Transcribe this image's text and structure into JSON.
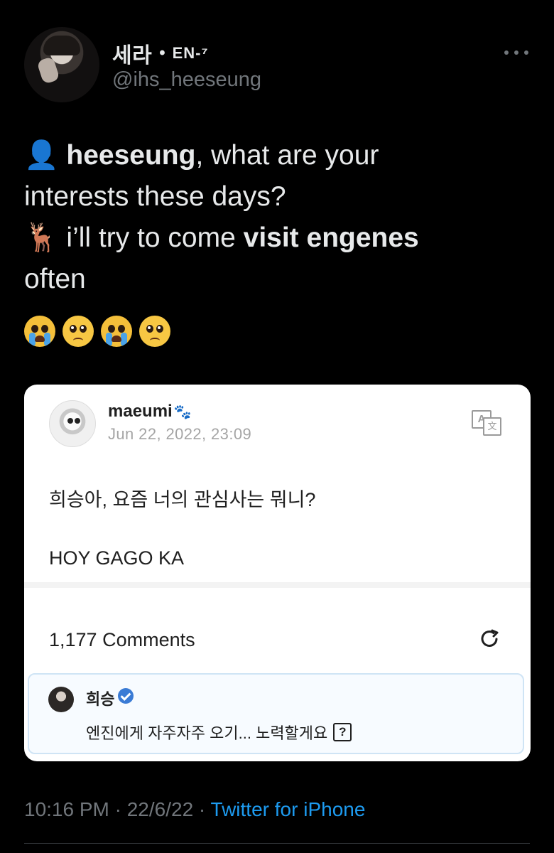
{
  "author": {
    "display_name": "세라",
    "separator": "•",
    "tag": "EN-⁷",
    "handle": "@ihs_heeseung"
  },
  "tweet": {
    "line1_prefix_emoji": "👤",
    "line1_bold": "heeseung",
    "line1_rest": ", what are your",
    "line2": "interests these days?",
    "line3_prefix_emoji": "🦌",
    "line3_text": " i’ll try to come ",
    "line3_bold": "visit engenes",
    "line4": "often",
    "reactions": [
      "crying-face",
      "pleading-face",
      "crying-face",
      "pleading-face"
    ]
  },
  "card": {
    "username": "maeumi",
    "paw_icon": "🐾",
    "date": "Jun 22, 2022, 23:09",
    "translate_icon": {
      "top": "A",
      "bottom": "文"
    },
    "question": "희승아, 요즘 너의 관심사는 뭐니?",
    "answer": "HOY GAGO KA",
    "comments": "1,177 Comments",
    "reply": {
      "name": "희승",
      "text": "엔진에게 자주자주 오기... 노력할게요",
      "help_label": "?"
    }
  },
  "footer": {
    "time": "10:16 PM · 22/6/22 · ",
    "source": "Twitter for iPhone"
  },
  "colors": {
    "background": "#000000",
    "text": "#e7e9ea",
    "muted": "#71767b",
    "link": "#1d9bf0",
    "verified": "#3a7bd5"
  }
}
